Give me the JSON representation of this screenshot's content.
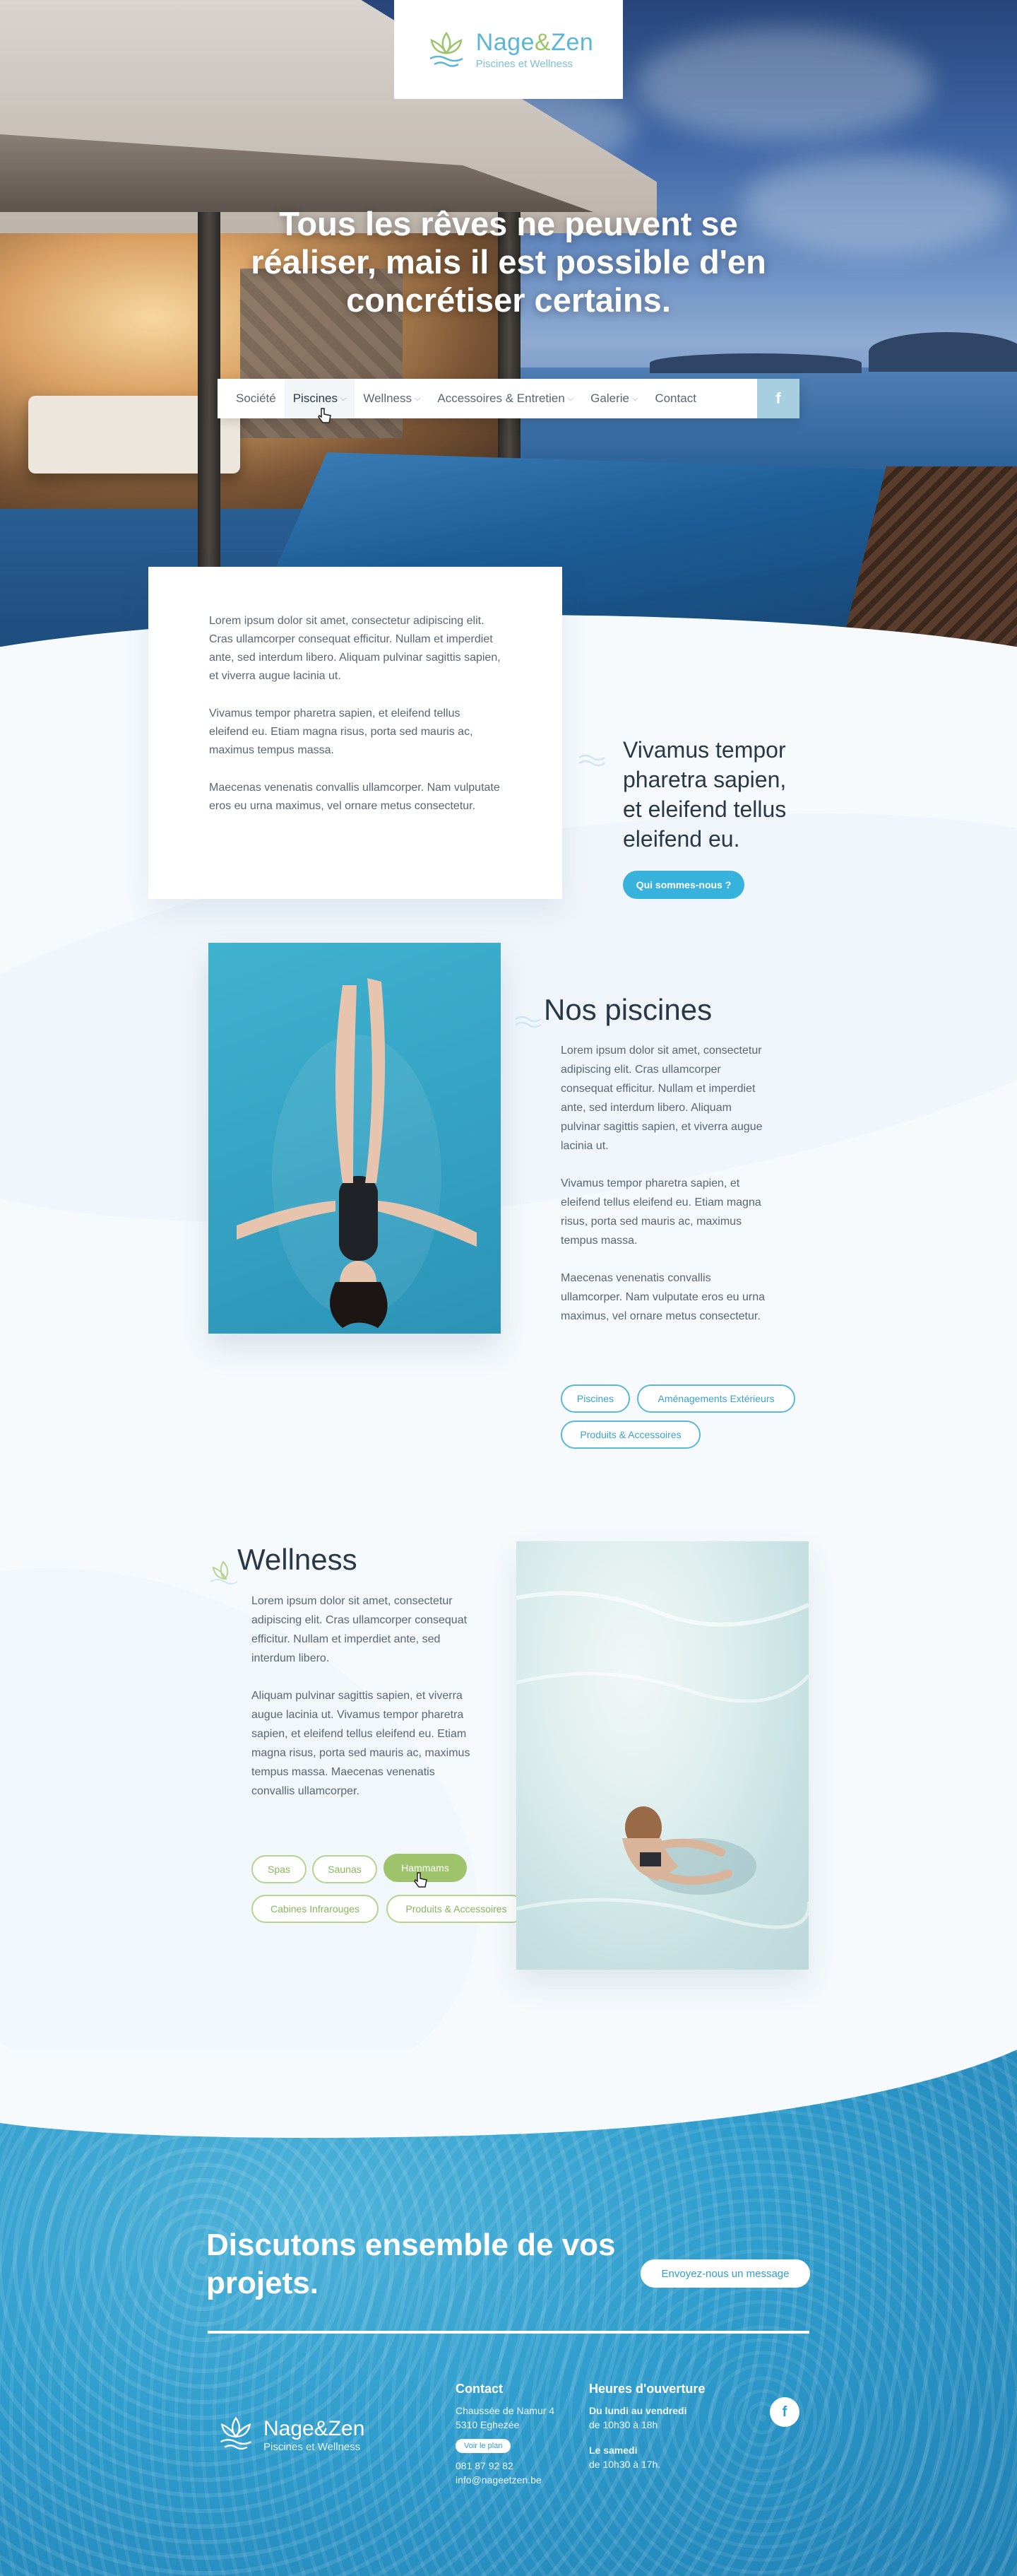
{
  "brand": {
    "name": "Nage&Zen",
    "name_main": "Nage",
    "name_amp": "&",
    "name_end": "Zen",
    "tagline": "Piscines et Wellness",
    "colors": {
      "primary_blue": "#37b2dd",
      "accent_green": "#9dc46a",
      "text_dark": "#2a3846"
    }
  },
  "hero": {
    "title": "Tous les rêves ne peuvent se réaliser, mais il est possible d'en concrétiser certains."
  },
  "nav": {
    "items": [
      {
        "label": "Société",
        "has_dropdown": false
      },
      {
        "label": "Piscines",
        "has_dropdown": true,
        "active": true
      },
      {
        "label": "Wellness",
        "has_dropdown": true
      },
      {
        "label": "Accessoires & Entretien",
        "has_dropdown": true
      },
      {
        "label": "Galerie",
        "has_dropdown": true
      },
      {
        "label": "Contact",
        "has_dropdown": false
      }
    ],
    "facebook_icon": "f"
  },
  "intro": {
    "paragraphs": [
      "Lorem ipsum dolor sit amet, consectetur adipiscing elit. Cras ullamcorper consequat efficitur. Nullam et imperdiet ante, sed interdum libero. Aliquam pulvinar sagittis sapien, et viverra augue lacinia ut.",
      "Vivamus tempor pharetra sapien, et eleifend tellus eleifend eu. Etiam magna risus, porta sed mauris ac, maximus tempus massa.",
      "Maecenas venenatis convallis ullamcorper. Nam vulputate eros eu urna maximus, vel ornare metus consectetur."
    ],
    "quote": "Vivamus tempor pharetra sapien, et eleifend tellus eleifend eu.",
    "button": "Qui sommes-nous ?"
  },
  "piscines": {
    "title": "Nos piscines",
    "paragraphs": [
      "Lorem ipsum dolor sit amet, consectetur adipiscing elit. Cras ullamcorper consequat efficitur. Nullam et imperdiet ante, sed interdum libero. Aliquam pulvinar sagittis sapien, et viverra augue lacinia ut.",
      "Vivamus tempor pharetra sapien, et eleifend tellus eleifend eu. Etiam magna risus, porta sed mauris ac, maximus tempus massa.",
      "Maecenas venenatis convallis ullamcorper. Nam vulputate eros eu urna maximus, vel ornare metus consectetur."
    ],
    "tags": [
      "Piscines",
      "Aménagements Extérieurs",
      "Produits & Accessoires"
    ]
  },
  "wellness": {
    "title": "Wellness",
    "paragraphs": [
      "Lorem ipsum dolor sit amet, consectetur adipiscing elit. Cras ullamcorper consequat efficitur. Nullam et imperdiet ante, sed interdum libero.",
      "Aliquam pulvinar sagittis sapien, et viverra augue lacinia ut. Vivamus tempor pharetra sapien, et eleifend tellus eleifend eu. Etiam magna risus, porta sed mauris ac, maximus tempus massa. Maecenas venenatis convallis ullamcorper."
    ],
    "tags": [
      "Spas",
      "Saunas",
      "Hammams",
      "Cabines Infrarouges",
      "Produits & Accessoires"
    ],
    "active_tag": "Hammams"
  },
  "footer": {
    "cta_title": "Discutons ensemble de vos projets.",
    "cta_button": "Envoyez-nous un message",
    "contact": {
      "title": "Contact",
      "address_1": "Chaussée de Namur 4",
      "address_2": "5310 Eghezée",
      "plan_button": "Voir le plan",
      "phone": "081 87 92 82",
      "email": "info@nageetzen.be"
    },
    "hours": {
      "title": "Heures d'ouverture",
      "weekday_label": "Du lundi au vendredi",
      "weekday_hours": "de 10h30 à 18h",
      "saturday_label": "Le samedi",
      "saturday_hours": "de 10h30 à 17h."
    },
    "facebook_icon": "f"
  }
}
